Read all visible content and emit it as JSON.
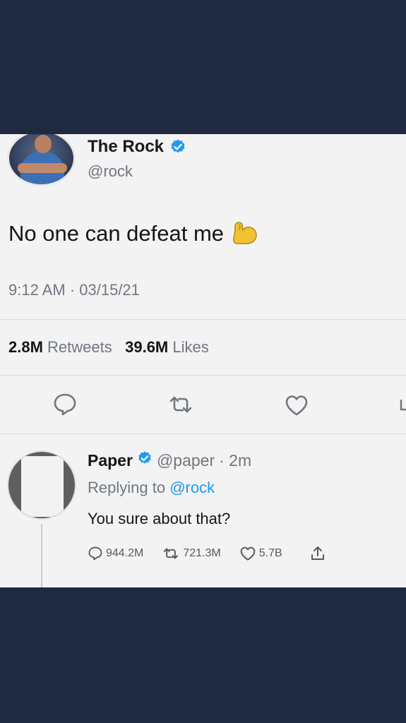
{
  "colors": {
    "background": "#1f2a40",
    "card": "#f3f3f3",
    "verified": "#1d9bf0",
    "muted": "#6f7780"
  },
  "main_tweet": {
    "display_name": "The Rock",
    "handle": "@rock",
    "verified_icon": "verified-badge-icon",
    "text": "No one can defeat me",
    "emoji": "flexed-biceps-icon",
    "timestamp": "9:12 AM · 03/15/21",
    "retweets_count": "2.8M",
    "retweets_label": "Retweets",
    "likes_count": "39.6M",
    "likes_label": "Likes",
    "actions": [
      "reply-icon",
      "retweet-icon",
      "like-icon",
      "share-icon"
    ]
  },
  "reply": {
    "display_name": "Paper",
    "handle": "@paper",
    "time": "· 2m",
    "replying_prefix": "Replying to",
    "replying_to": "@rock",
    "text": "You sure about that?",
    "reply_count": "944.2M",
    "retweet_count": "721.3M",
    "like_count": "5.7B"
  }
}
